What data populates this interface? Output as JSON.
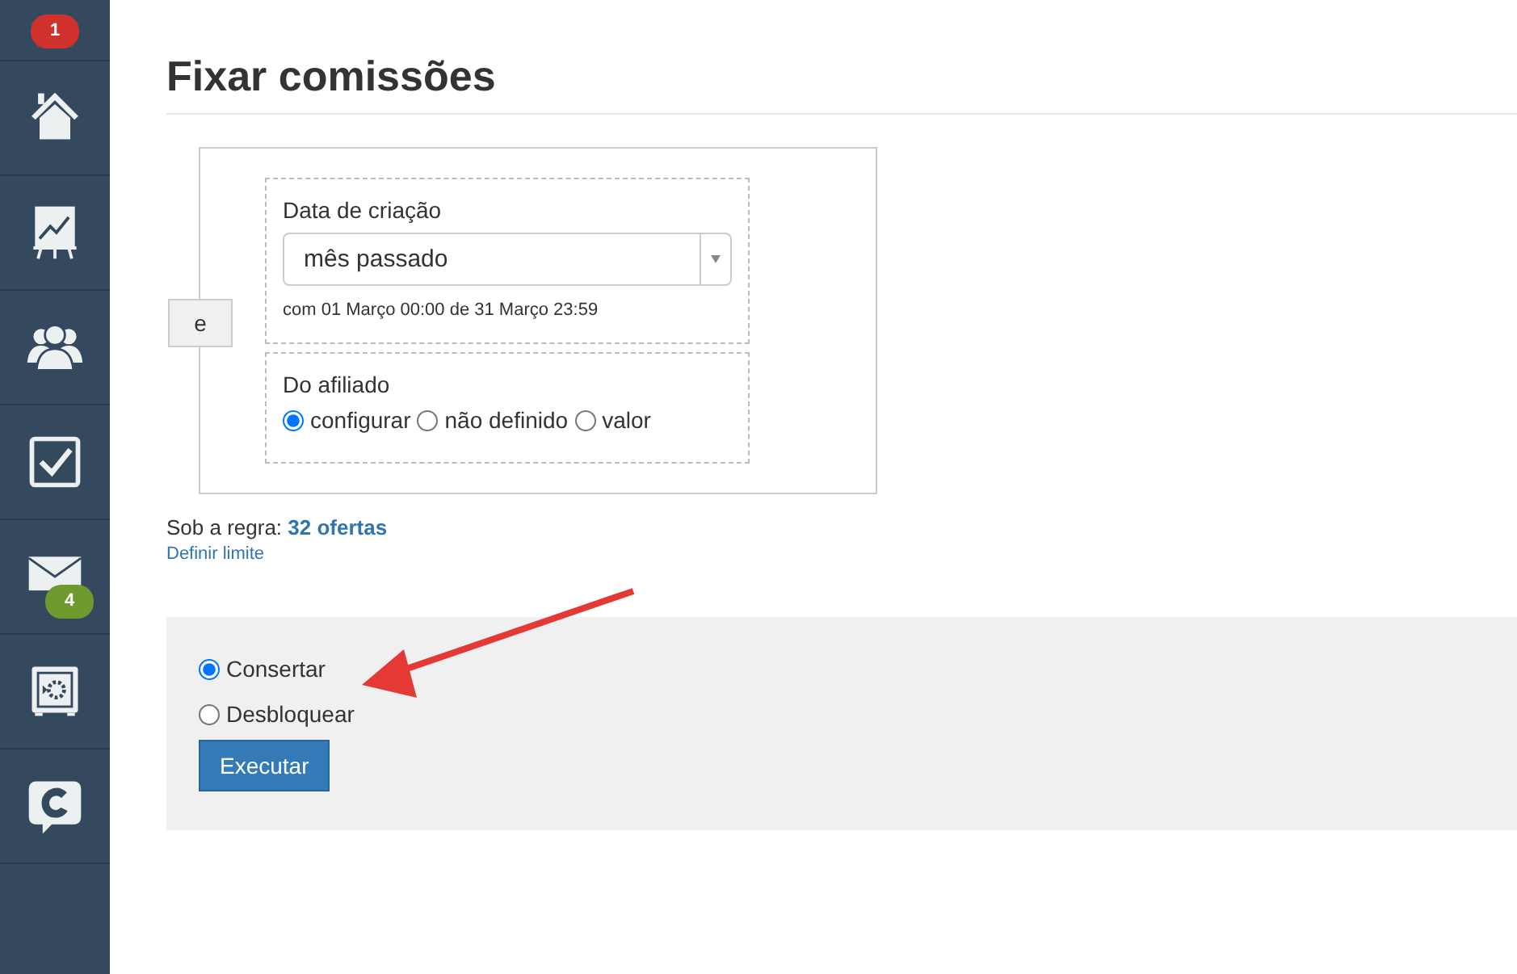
{
  "sidebar": {
    "top_badge": "1",
    "items": [
      {
        "kind": "home"
      },
      {
        "kind": "chart"
      },
      {
        "kind": "people"
      },
      {
        "kind": "tasks"
      },
      {
        "kind": "mail",
        "badge": "4"
      },
      {
        "kind": "safe"
      },
      {
        "kind": "chat"
      }
    ]
  },
  "page_title": "Fixar comissões",
  "rule": {
    "operator": "e",
    "conditions": [
      {
        "kind": "select",
        "label": "Data de criação",
        "value": "mês passado",
        "note": "com 01 Março 00:00 de 31 Março 23:59"
      },
      {
        "kind": "radios",
        "label": "Do afiliado",
        "options": [
          {
            "label": "configurar",
            "selected": true
          },
          {
            "label": "não definido",
            "selected": false
          },
          {
            "label": "valor",
            "selected": false
          }
        ]
      }
    ]
  },
  "summary": {
    "text": "Sob a regra: **32 ofertas**",
    "link": "Definir limite"
  },
  "action_panel": {
    "options": [
      {
        "label": "Consertar",
        "selected": true
      },
      {
        "label": "Desbloquear",
        "selected": false
      }
    ],
    "button": "Executar"
  }
}
